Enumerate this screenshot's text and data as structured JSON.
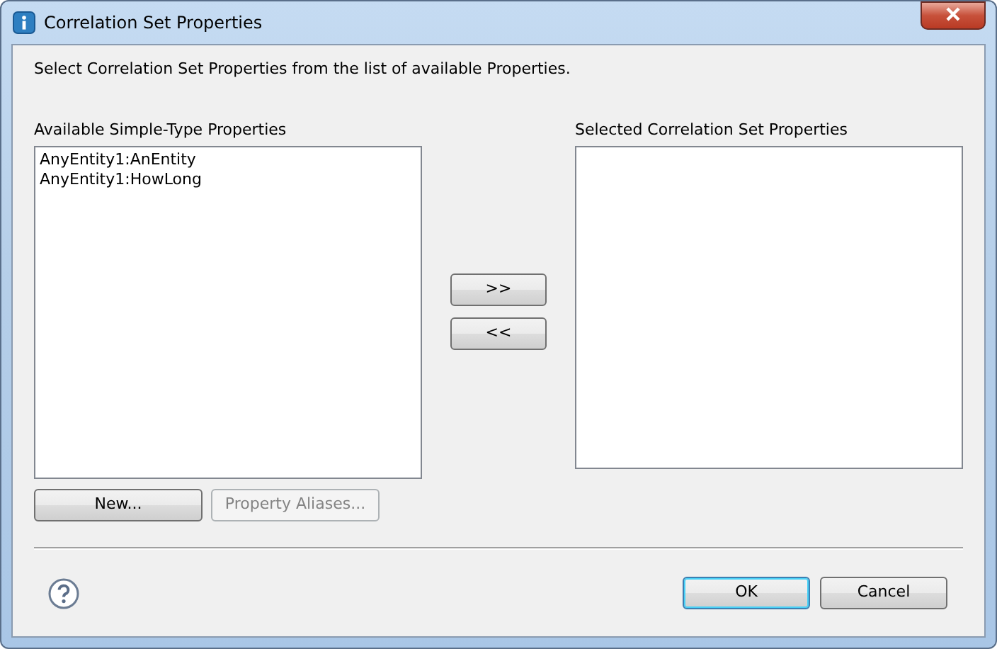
{
  "window": {
    "title": "Correlation Set Properties"
  },
  "instruction": "Select Correlation Set Properties from the list of available Properties.",
  "available": {
    "label": "Available Simple-Type Properties",
    "items": [
      {
        "text": "AnyEntity1:AnEntity",
        "selected": false
      },
      {
        "text": "AnyEntity1:HowLong",
        "selected": false
      }
    ],
    "buttons": [
      {
        "label": "New...",
        "disabled": false
      },
      {
        "label": "Property Aliases...",
        "disabled": true
      }
    ]
  },
  "transfer_buttons": [
    {
      "label": ">>"
    },
    {
      "label": "<<"
    }
  ],
  "selected_list": {
    "label": "Selected Correlation Set Properties"
  },
  "footer_buttons": [
    {
      "label": "OK",
      "default": true
    },
    {
      "label": "Cancel",
      "default": false
    }
  ]
}
